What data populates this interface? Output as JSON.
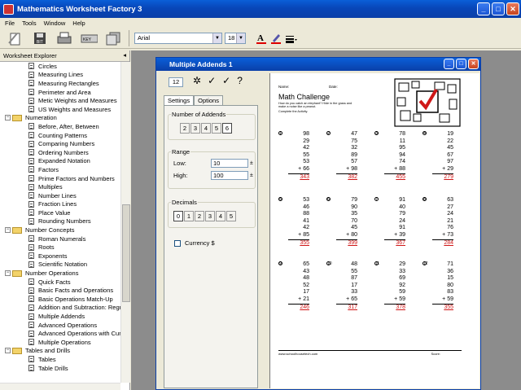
{
  "app_title": "Mathematics Worksheet Factory 3",
  "menu": [
    "File",
    "Tools",
    "Window",
    "Help"
  ],
  "toolbar": {
    "font": "Arial",
    "size": "18"
  },
  "explorer_title": "Worksheet Explorer",
  "tree": [
    {
      "t": "doc",
      "l": "Circles"
    },
    {
      "t": "doc",
      "l": "Measuring Lines"
    },
    {
      "t": "doc",
      "l": "Measuring Rectangles"
    },
    {
      "t": "doc",
      "l": "Perimeter and Area"
    },
    {
      "t": "doc",
      "l": "Metic Weights and Measures"
    },
    {
      "t": "doc",
      "l": "US Weights and Measures"
    },
    {
      "t": "folder",
      "l": "Numeration"
    },
    {
      "t": "doc",
      "l": "Before, After, Between"
    },
    {
      "t": "doc",
      "l": "Counting Patterns"
    },
    {
      "t": "doc",
      "l": "Comparing Numbers"
    },
    {
      "t": "doc",
      "l": "Ordering Numbers"
    },
    {
      "t": "doc",
      "l": "Expanded Notation"
    },
    {
      "t": "doc",
      "l": "Factors"
    },
    {
      "t": "doc",
      "l": "Prime Factors and Numbers"
    },
    {
      "t": "doc",
      "l": "Multiples"
    },
    {
      "t": "doc",
      "l": "Number Lines"
    },
    {
      "t": "doc",
      "l": "Fraction Lines"
    },
    {
      "t": "doc",
      "l": "Place Value"
    },
    {
      "t": "doc",
      "l": "Rounding Numbers"
    },
    {
      "t": "folder",
      "l": "Number Concepts"
    },
    {
      "t": "doc",
      "l": "Roman Numerals"
    },
    {
      "t": "doc",
      "l": "Roots"
    },
    {
      "t": "doc",
      "l": "Exponents"
    },
    {
      "t": "doc",
      "l": "Scientific Notation"
    },
    {
      "t": "folder",
      "l": "Number Operations"
    },
    {
      "t": "doc",
      "l": "Quick Facts"
    },
    {
      "t": "doc",
      "l": "Basic Facts and Operations"
    },
    {
      "t": "doc",
      "l": "Basic Operations Match-Up"
    },
    {
      "t": "doc",
      "l": "Addition and Subtraction: Regro"
    },
    {
      "t": "doc",
      "l": "Multiple Addends"
    },
    {
      "t": "doc",
      "l": "Advanced Operations"
    },
    {
      "t": "doc",
      "l": "Advanced Operations with Curre"
    },
    {
      "t": "doc",
      "l": "Multiple Operations"
    },
    {
      "t": "folder",
      "l": "Tables and Drills"
    },
    {
      "t": "doc",
      "l": "Tables"
    },
    {
      "t": "doc",
      "l": "Table Drills"
    }
  ],
  "child_title": "Multiple Addends 1",
  "settings": {
    "count": "12",
    "tab_settings": "Settings",
    "tab_options": "Options",
    "addends_label": "Number of Addends",
    "addends": [
      "2",
      "3",
      "4",
      "5",
      "6"
    ],
    "range_label": "Range",
    "low_label": "Low:",
    "low": "10",
    "high_label": "High:",
    "high": "100",
    "decimals_label": "Decimals",
    "decimals": [
      "0",
      "1",
      "2",
      "3",
      "4",
      "5"
    ],
    "currency": "Currency $"
  },
  "worksheet": {
    "name": "Name:",
    "date": "Date:",
    "title": "Math Challenge",
    "sub1": "How do you catch an elephant? Hide in the grass and make a noise like a peanut.",
    "sub2": "Complete the Activity.",
    "footer_left": "www.schoolhousetech.com",
    "footer_right": "Score:",
    "problems": [
      {
        "i": "1",
        "nums": [
          "98",
          "29",
          "42",
          "55",
          "53"
        ],
        "last": "+ 66",
        "ans": "343"
      },
      {
        "i": "2",
        "nums": [
          "47",
          "75",
          "32",
          "89",
          "57"
        ],
        "last": "+ 98",
        "ans": "382"
      },
      {
        "i": "3",
        "nums": [
          "78",
          "11",
          "95",
          "94",
          "74"
        ],
        "last": "+ 88",
        "ans": "455"
      },
      {
        "i": "4",
        "nums": [
          "19",
          "22",
          "45",
          "67",
          "97"
        ],
        "last": "+ 29",
        "ans": "279"
      },
      {
        "i": "5",
        "nums": [
          "53",
          "46",
          "88",
          "41",
          "42"
        ],
        "last": "+ 85",
        "ans": "355"
      },
      {
        "i": "6",
        "nums": [
          "79",
          "90",
          "35",
          "70",
          "45"
        ],
        "last": "+ 80",
        "ans": "399"
      },
      {
        "i": "7",
        "nums": [
          "91",
          "40",
          "79",
          "24",
          "91"
        ],
        "last": "+ 39",
        "ans": "367"
      },
      {
        "i": "8",
        "nums": [
          "63",
          "27",
          "24",
          "21",
          "76"
        ],
        "last": "+ 73",
        "ans": "284"
      },
      {
        "i": "9",
        "nums": [
          "65",
          "43",
          "48",
          "52",
          "17"
        ],
        "last": "+ 21",
        "ans": "246"
      },
      {
        "i": "10",
        "nums": [
          "48",
          "55",
          "87",
          "17",
          "33"
        ],
        "last": "+ 65",
        "ans": "317"
      },
      {
        "i": "11",
        "nums": [
          "29",
          "33",
          "69",
          "92",
          "59"
        ],
        "last": "+ 59",
        "ans": "378"
      },
      {
        "i": "12",
        "nums": [
          "71",
          "36",
          "15",
          "80",
          "83"
        ],
        "last": "+ 59",
        "ans": "355"
      }
    ]
  }
}
